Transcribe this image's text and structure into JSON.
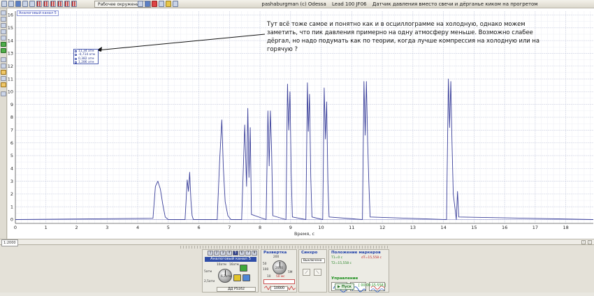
{
  "title": {
    "author": "pashaburgman (c) Odessa",
    "car": "Lead 100 JF06",
    "description": "Датчик давления вместо свечи и дёрганье киком на прогретом"
  },
  "toolbar": {
    "mode_label": "Рабочее окружение"
  },
  "plot": {
    "channel_label": "Аналоговый канал 5",
    "annotation": "Тут всё тоже самое и понятно как и в осциллограмме на холодную, однако можем заметить, что пик давления примерно на одну атмосферу меньше. Возможно слабее дёргал, но надо подумать как по теории, когда лучше компрессия на холодную или на горячую ?",
    "markers": [
      "11,34 атм",
      "-0,714 атм",
      "0,382 атм",
      "1,286 атм"
    ],
    "marker_colors": [
      "#4b5bb0",
      "#4b5bb0",
      "#4b5bb0",
      "#4b5bb0"
    ]
  },
  "chart_data": {
    "type": "line",
    "xlabel": "Время, с",
    "ylabel": "",
    "xlim": [
      0,
      18.9
    ],
    "ylim": [
      -0.3,
      16.3
    ],
    "x_ticks": [
      "0",
      "1",
      "2",
      "3",
      "4",
      "5",
      "6",
      "7",
      "8",
      "9",
      "10",
      "11",
      "12",
      "13",
      "14",
      "15",
      "16",
      "17",
      "18"
    ],
    "y_ticks": [
      "0",
      "1",
      "2",
      "3",
      "4",
      "5",
      "6",
      "7",
      "8",
      "9",
      "10",
      "11",
      "12",
      "13",
      "14",
      "15",
      "16"
    ],
    "grid": true,
    "series": [
      {
        "color": "#3a3f9a",
        "x": [
          0,
          4.5,
          4.58,
          4.66,
          4.74,
          4.82,
          4.9,
          5.0,
          5.55,
          5.62,
          5.66,
          5.7,
          5.74,
          5.78,
          5.82,
          6.6,
          6.68,
          6.75,
          6.8,
          6.86,
          6.95,
          7.05,
          7.4,
          7.5,
          7.56,
          7.6,
          7.64,
          7.68,
          7.72,
          8.2,
          8.26,
          8.3,
          8.34,
          8.38,
          8.42,
          8.85,
          8.9,
          8.94,
          8.98,
          9.02,
          9.06,
          9.5,
          9.55,
          9.58,
          9.62,
          9.66,
          9.7,
          10.05,
          10.1,
          10.14,
          10.18,
          10.22,
          10.26,
          11.35,
          11.4,
          11.44,
          11.48,
          11.52,
          11.56,
          11.6,
          14.1,
          14.16,
          14.2,
          14.24,
          14.28,
          14.32,
          14.42,
          14.46,
          14.5,
          18.9
        ],
        "y": [
          0,
          0.1,
          2.6,
          3.0,
          2.4,
          1.2,
          0.2,
          0,
          0,
          3.1,
          2.2,
          3.7,
          1.5,
          0.3,
          0,
          0,
          4.6,
          7.8,
          4.2,
          1.4,
          0.3,
          0,
          0,
          7.4,
          2.6,
          8.7,
          3.3,
          7.2,
          0.4,
          0,
          8.5,
          4.2,
          8.5,
          5.3,
          0.3,
          0,
          10.6,
          7.0,
          10.0,
          3.6,
          0.2,
          0,
          10.7,
          6.9,
          9.8,
          3.3,
          0.2,
          0,
          10.3,
          6.3,
          9.2,
          3.0,
          0.2,
          0,
          10.8,
          6.6,
          10.8,
          6.1,
          2.9,
          0.2,
          0,
          11.0,
          7.2,
          10.8,
          6.0,
          2.0,
          0,
          2.2,
          0.2,
          0
        ]
      }
    ]
  },
  "bottom": {
    "zoom_label": "1:2000",
    "channel_title": "Аналоговый канал 5",
    "channel_sensor": "ДД PS162",
    "channel_knob_labels": [
      "10атм",
      "5атм",
      "2,5атм",
      "16атм",
      "6,3атм"
    ],
    "sweep_title": "Развертка",
    "sweep_value": "10000",
    "sweep_knob_labels": [
      "200",
      "50",
      "100",
      "10",
      "5M",
      "2000"
    ],
    "sweep_unit": "50 мс",
    "sync_title": "Синхро",
    "sync_mode": "Выключено",
    "markers_title": "Положение маркеров",
    "t1": "T1=0 с",
    "dt": "dT=15,558 с",
    "t2": "T2=15,558 с",
    "control_title": "Управление",
    "run_label": "Пуск",
    "timer": "[ 00:00:15:558 ]"
  }
}
